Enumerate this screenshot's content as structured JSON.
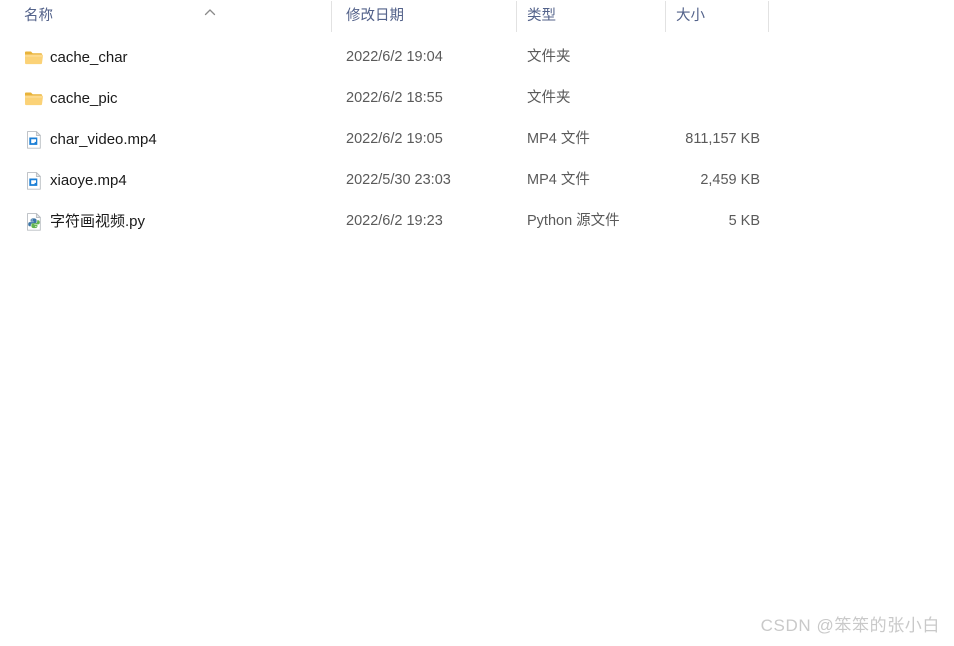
{
  "window": {
    "view": "details",
    "background_color": "#ffffff"
  },
  "columns": {
    "name": {
      "label": "名称",
      "sort": "ascending",
      "sort_icon": "chevron-up-icon"
    },
    "date_modified": {
      "label": "修改日期"
    },
    "type": {
      "label": "类型"
    },
    "size": {
      "label": "大小"
    }
  },
  "colors": {
    "header_text": "#53628a",
    "row_text": "#1a1a1a",
    "meta_text": "#5a5a5a",
    "separator": "#e2e2e2",
    "folder": "#f5c451",
    "folder_dark": "#e3a62c",
    "mp4_accent": "#1c7fd6",
    "watermark": "#c9c9c9"
  },
  "files": [
    {
      "name": "cache_char",
      "date_modified": "2022/6/2 19:04",
      "type": "文件夹",
      "size": "",
      "icon": "folder-icon"
    },
    {
      "name": "cache_pic",
      "date_modified": "2022/6/2 18:55",
      "type": "文件夹",
      "size": "",
      "icon": "folder-icon"
    },
    {
      "name": "char_video.mp4",
      "date_modified": "2022/6/2 19:05",
      "type": "MP4 文件",
      "size": "811,157 KB",
      "icon": "mp4-file-icon"
    },
    {
      "name": "xiaoye.mp4",
      "date_modified": "2022/5/30 23:03",
      "type": "MP4 文件",
      "size": "2,459 KB",
      "icon": "mp4-file-icon"
    },
    {
      "name": "字符画视频.py",
      "date_modified": "2022/6/2 19:23",
      "type": "Python 源文件",
      "size": "5 KB",
      "icon": "python-file-icon"
    }
  ],
  "watermark": {
    "text": "CSDN @笨笨的张小白"
  }
}
